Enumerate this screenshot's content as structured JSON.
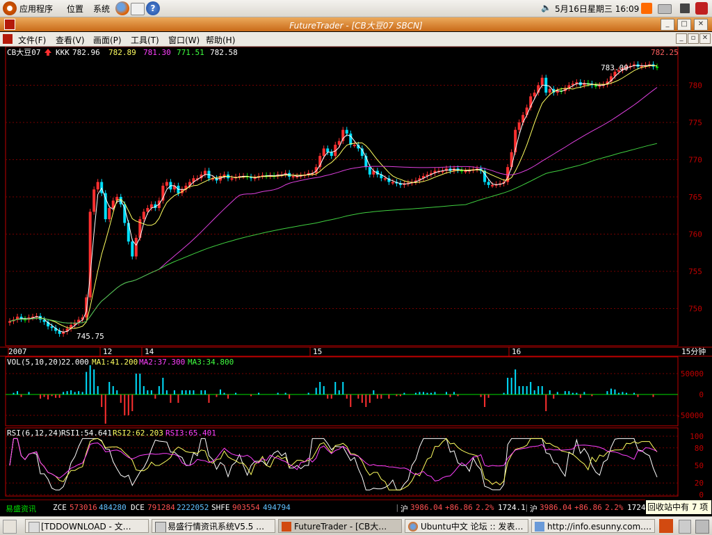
{
  "topbar": {
    "apps": "应用程序",
    "places": "位置",
    "system": "系统",
    "datetime": "5月16日星期三 16:09"
  },
  "window": {
    "title": "FutureTrader - [CB大豆07 SBCN]"
  },
  "menu": [
    "文件(F)",
    "查看(V)",
    "画面(P)",
    "工具(T)",
    "窗口(W)",
    "帮助(H)"
  ],
  "main_panel": {
    "symbol": "CB大豆07",
    "indicator": "KKK",
    "values": [
      "782.96",
      "782.89",
      "781.30",
      "771.51",
      "782.58"
    ],
    "last_price": "782.25",
    "high_label": "783.00",
    "low_label": "745.75",
    "price_ticks": [
      "780",
      "775",
      "770",
      "765",
      "760",
      "755",
      "750"
    ],
    "date_labels": [
      "2007",
      "12",
      "14",
      "15",
      "16"
    ],
    "period": "15分钟"
  },
  "vol_panel": {
    "label": "VOL(5,10,20)",
    "vol": "22.000",
    "ma1": "MA1:41.200",
    "ma2": "MA2:37.300",
    "ma3": "MA3:34.800",
    "ticks": [
      "50000",
      "0",
      "-50000"
    ]
  },
  "rsi_panel": {
    "label": "RSI(6,12,24)",
    "rsi1": "RSI1:54.641",
    "rsi2": "RSI2:62.203",
    "rsi3": "RSI3:65.401",
    "ticks": [
      "100",
      "80",
      "50",
      "20",
      "0"
    ]
  },
  "statusbar": {
    "brand": "易盛资讯",
    "zce": "ZCE",
    "zce1": "573016",
    "zce2": "484280",
    "dce": "DCE",
    "dce1": "791284",
    "dce2": "2222052",
    "shfe": "SHFE",
    "shfe1": "903554",
    "shfe2": "494794",
    "hu1": "沪",
    "hu1val": "3986.04",
    "hu1chg": "+86.86",
    "hu1pct": "2.2%",
    "hu1x": "1724.1",
    "hu2": "沪",
    "hu2val": "3986.04",
    "hu2chg": "+86.86",
    "hu2pct": "2.2%",
    "hu2x": "1724"
  },
  "tooltip": "回收站中有 7 项",
  "taskbar": [
    "[TDDOWNLOAD - 文…",
    "易盛行情资讯系统V5.5 …",
    "FutureTrader - [CB大…",
    "Ubuntu中文 论坛 :: 发表…",
    "http://info.esunny.com.…"
  ],
  "colors": {
    "up": "#ff3030",
    "down": "#00e0ff",
    "green": "#00e000",
    "ma_yellow": "#ffff60",
    "ma_magenta": "#e040e0",
    "ma_green": "#40d040",
    "axis": "#c00000"
  },
  "chart_data": {
    "type": "candlestick",
    "x_axis": [
      "2007",
      "12",
      "14",
      "15",
      "16"
    ],
    "price_range": [
      745,
      783
    ],
    "close_series": [
      748.3,
      748.5,
      748.9,
      748.6,
      748.5,
      748.8,
      748.9,
      749.0,
      748.5,
      748.2,
      747.6,
      747.4,
      747.0,
      746.6,
      746.9,
      747.3,
      747.8,
      748.1,
      748.5,
      748.8,
      751.5,
      763.0,
      766.0,
      767.0,
      765.5,
      762.0,
      763.5,
      764.5,
      765.0,
      764.0,
      761.5,
      759.0,
      757.0,
      759.5,
      762.0,
      763.0,
      763.5,
      764.0,
      763.5,
      764.5,
      766.5,
      767.0,
      766.0,
      766.5,
      765.5,
      766.0,
      766.5,
      767.0,
      767.5,
      767.5,
      768.0,
      768.5,
      767.5,
      767.5,
      767.2,
      767.8,
      768.0,
      767.5,
      767.5,
      767.7,
      767.8,
      767.8,
      767.7,
      767.5,
      767.6,
      767.8,
      767.9,
      767.8,
      767.9,
      767.8,
      768.0,
      768.0,
      768.2,
      767.7,
      767.8,
      767.8,
      767.9,
      768.0,
      768.2,
      768.2,
      769.0,
      770.5,
      771.5,
      771.0,
      770.5,
      772.0,
      772.5,
      774.0,
      773.5,
      772.0,
      772.0,
      771.5,
      770.5,
      769.0,
      768.0,
      768.5,
      768.0,
      767.5,
      767.5,
      767.0,
      767.0,
      766.8,
      766.6,
      766.8,
      766.9,
      767.0,
      767.2,
      767.5,
      767.8,
      768.0,
      768.2,
      768.5,
      768.5,
      768.5,
      768.8,
      768.5,
      768.8,
      768.6,
      768.5,
      768.5,
      768.6,
      768.7,
      768.8,
      768.5,
      767.0,
      766.6,
      766.6,
      766.7,
      766.8,
      767.0,
      769.0,
      771.0,
      774.0,
      775.0,
      776.0,
      777.0,
      778.5,
      779.0,
      780.0,
      781.0,
      779.0,
      779.5,
      779.0,
      779.3,
      779.2,
      779.6,
      780.0,
      780.2,
      780.4,
      780.0,
      780.3,
      780.2,
      780.0,
      779.9,
      780.0,
      780.1,
      780.5,
      781.2,
      781.8,
      782.0,
      782.3,
      782.5,
      782.6,
      782.8,
      782.5,
      782.6,
      782.7,
      782.8,
      782.5,
      782.4
    ],
    "volume_range": [
      -70000,
      70000
    ],
    "rsi_range": [
      0,
      100
    ]
  }
}
